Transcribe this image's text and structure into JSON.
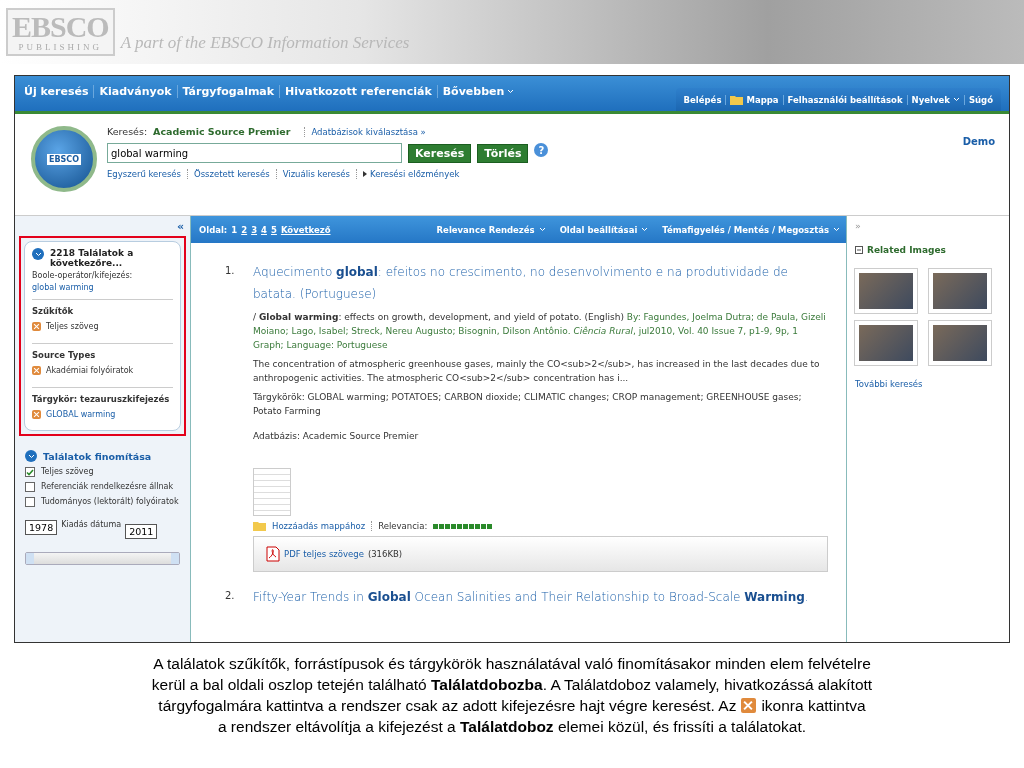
{
  "banner": {
    "logo_top": "EBSCO",
    "logo_bottom": "PUBLISHING",
    "tagline": "A part of the EBSCO Information Services"
  },
  "nav": {
    "left": [
      {
        "label": "Új keresés",
        "dropdown": false
      },
      {
        "label": "Kiadványok",
        "dropdown": false
      },
      {
        "label": "Tárgyfogalmak",
        "dropdown": false
      },
      {
        "label": "Hivatkozott referenciák",
        "dropdown": false
      },
      {
        "label": "Bővebben",
        "dropdown": true
      }
    ],
    "right": [
      {
        "label": "Belépés",
        "kind": "plain",
        "dropdown": false
      },
      {
        "label": "Mappa",
        "kind": "folder",
        "dropdown": false
      },
      {
        "label": "Felhasználói beállítások",
        "kind": "plain",
        "dropdown": false
      },
      {
        "label": "Nyelvek",
        "kind": "plain",
        "dropdown": true
      },
      {
        "label": "Súgó",
        "kind": "plain",
        "dropdown": false
      }
    ]
  },
  "search": {
    "logo_text": "EBSCO",
    "label": "Keresés:",
    "database": "Academic Source Premier",
    "choose_db": "Adatbázisok kiválasztása »",
    "value": "global warming",
    "buttons": [
      "Keresés",
      "Törlés"
    ],
    "help": "?",
    "links": [
      {
        "label": "Egyszerű keresés",
        "kind": "plain"
      },
      {
        "label": "Összetett keresés",
        "kind": "plain"
      },
      {
        "label": "Vizuális keresés",
        "kind": "plain"
      },
      {
        "label": "Keresési előzmények",
        "kind": "arrow"
      }
    ],
    "user": "Demo"
  },
  "left": {
    "collapse": "«",
    "results_box": {
      "title": "2218 Találatok a következőre...",
      "boolean_label": "Boole-operátor/kifejezés:",
      "boolean_value": "global warming",
      "sections": [
        {
          "heading": "Szűkítők",
          "items": [
            {
              "label": "Teljes szöveg",
              "link": false
            }
          ]
        },
        {
          "heading": "Source Types",
          "items": [
            {
              "label": "Akadémiai folyóiratok",
              "link": false
            }
          ]
        },
        {
          "heading": "Tárgykör: tezauruszkifejezés",
          "items": [
            {
              "label": "GLOBAL warming",
              "link": true
            }
          ]
        }
      ]
    },
    "refine": {
      "heading": "Találatok finomítása",
      "checkboxes": [
        {
          "label": "Teljes szöveg",
          "checked": true
        },
        {
          "label": "Referenciák rendelkezésre állnak",
          "checked": false
        },
        {
          "label": "Tudományos (lektorált) folyóiratok",
          "checked": false
        }
      ],
      "date_from": "1978",
      "date_label": "Kiadás dátuma",
      "date_to": "2011",
      "slider": {
        "level": 1
      }
    }
  },
  "toolbar": {
    "page_label": "Oldal:",
    "pages": [
      {
        "label": "1",
        "selected": true
      },
      {
        "label": "2",
        "selected": false
      },
      {
        "label": "3",
        "selected": false
      },
      {
        "label": "4",
        "selected": false
      },
      {
        "label": "5",
        "selected": false
      }
    ],
    "next": "Következő",
    "menus": [
      "Relevance Rendezés",
      "Oldal beállításai",
      "Témafigyelés / Mentés / Megosztás"
    ]
  },
  "results": [
    {
      "number": "1.",
      "title": "Aquecimento **global**: efeitos no crescimento, no desenvolvimento e na produtividade de batata. (Portuguese)",
      "title_en": "/ **Global warming**: effects on growth, development, and yield of potato. (English)",
      "byline": "By: Fagundes, Joelma Dutra; de Paula, Gizeli Moiano; Lago, Isabel; Streck, Nereu Augusto; Bisognin, Dilson Antônio. *Ciência Rural*, jul2010, Vol. 40 Issue 7, p1-9, 9p, 1 Graph; Language: Portuguese",
      "abstract": "The concentration of atmospheric greenhouse gases, mainly the CO<sub>2</sub>, has increased in the last decades due to anthropogenic activities. The atmospheric CO<sub>2</sub> concentration has i...",
      "subjects": "Tárgykörök: GLOBAL warming; POTATOES; CARBON dioxide; CLIMATIC changes; CROP management; GREENHOUSE gases; Potato Farming",
      "database": "Adatbázis: Academic Source Premier",
      "add_folder": "Hozzáadás mappához",
      "relevance_label": "Relevancia:",
      "level": 1,
      "pdf_link": "PDF teljes szövege",
      "pdf_size": "(316KB)"
    },
    {
      "number": "2.",
      "title": "Fifty-Year Trends in **Global** Ocean Salinities and Their Relationship to Broad-Scale **Warming**."
    }
  ],
  "right": {
    "expand": "»",
    "heading": "Related Images",
    "images": [
      {
        "kind": "photo"
      },
      {
        "kind": "photo"
      },
      {
        "kind": "photo"
      },
      {
        "kind": "photo"
      }
    ],
    "more": "További keresés"
  },
  "caption": [
    [
      {
        "kind": "text",
        "text": "A találatok szűkítők, forrástípusok és tárgykörök használatával való finomításakor minden elem felvételre"
      }
    ],
    [
      {
        "kind": "text",
        "text": "kerül a bal oldali oszlop tetején található **Találatdobozba**. A Találatdoboz valamely, hivatkozássá alakított"
      }
    ],
    [
      {
        "kind": "text",
        "text": "tárgyfogalmára kattintva a rendszer csak az adott kifejezésre hajt végre keresést. Az"
      },
      {
        "kind": "icon"
      },
      {
        "kind": "text",
        "text": "ikonra kattintva"
      }
    ],
    [
      {
        "kind": "text",
        "text": "a rendszer eltávolítja a kifejezést a **Találatdoboz** elemei közül, és frissíti a találatokat."
      }
    ]
  ]
}
